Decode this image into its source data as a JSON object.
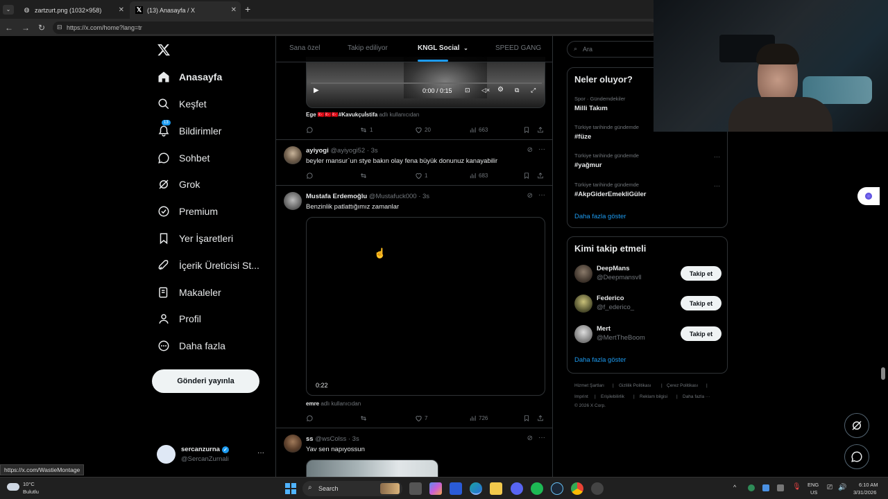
{
  "browser": {
    "tabs": [
      {
        "title": "zartzurt.png (1032×958)"
      },
      {
        "title": "(13) Anasayfa / X"
      }
    ],
    "url": "https://x.com/home?lang=tr"
  },
  "nav": {
    "items": [
      {
        "label": "Anasayfa"
      },
      {
        "label": "Keşfet"
      },
      {
        "label": "Bildirimler",
        "badge": "13"
      },
      {
        "label": "Sohbet"
      },
      {
        "label": "Grok"
      },
      {
        "label": "Premium"
      },
      {
        "label": "Yer İşaretleri"
      },
      {
        "label": "İçerik Üreticisi St..."
      },
      {
        "label": "Makaleler"
      },
      {
        "label": "Profil"
      },
      {
        "label": "Daha fazla"
      }
    ],
    "post_button": "Gönderi yayınla",
    "profile": {
      "name": "sercanzurna",
      "handle": "@SercanZurnali"
    }
  },
  "feed": {
    "tabs": [
      "Sana özel",
      "Takip ediliyor",
      "KNGL Social",
      "SPEED GANG"
    ],
    "video1": {
      "time": "0:00 / 0:15"
    },
    "tweet1": {
      "attrib_name": "Ege 🇹🇷🇹🇷🇹🇷#Kavukçuİstifa",
      "attrib_suffix": "adlı kullanıcıdan",
      "replies": "",
      "reposts": "1",
      "likes": "20",
      "views": "663"
    },
    "tweet2": {
      "name": "ayiyogi",
      "meta": "@ayiyogi52 · 3s",
      "text": "beyler mansur`un stye bakın olay fena büyük donunuz kanayabilir",
      "replies": "",
      "reposts": "",
      "likes": "1",
      "views": "683"
    },
    "tweet3": {
      "name": "Mustafa Erdemoğlu",
      "meta": "@Mustafuck000 · 3s",
      "text": "Benzinlik patlattığımız zamanlar",
      "duration": "0:22",
      "attrib_name": "emre",
      "attrib_suffix": "adlı kullanıcıdan",
      "replies": "",
      "reposts": "",
      "likes": "7",
      "views": "726"
    },
    "tweet4": {
      "name": "ss",
      "meta": "@wsColss · 3s",
      "text": "Yav sen napıyossun"
    }
  },
  "right": {
    "search_placeholder": "Ara",
    "trends_title": "Neler oluyor?",
    "trends": [
      {
        "meta": "Spor · Gündemdekiler",
        "name": "Milli Takım"
      },
      {
        "meta": "Türkiye tarihinde gündemde",
        "name": "#füze"
      },
      {
        "meta": "Türkiye tarihinde gündemde",
        "name": "#yağmur"
      },
      {
        "meta": "Türkiye tarihinde gündemde",
        "name": "#AkpGiderEmekliGüler"
      }
    ],
    "show_more": "Daha fazla göster",
    "who_title": "Kimi takip etmeli",
    "who": [
      {
        "name": "DeepMans",
        "handle": "@Deepmansvll",
        "button": "Takip et"
      },
      {
        "name": "Federico",
        "handle": "@f_ederico_",
        "button": "Takip et"
      },
      {
        "name": "Mert",
        "handle": "@MertTheBoom",
        "button": "Takip et"
      }
    ],
    "footer": [
      "Hizmet Şartları",
      "|",
      "Gizlilik Politikası",
      "|",
      "Çerez Politikası",
      "|",
      "Imprint",
      "|",
      "Erişilebilirlik",
      "|",
      "Reklam bilgisi",
      "|",
      "Daha fazla ···",
      "© 2026 X Corp."
    ]
  },
  "status_url": "https://x.com/WastieMontage",
  "taskbar": {
    "weather_temp": "10°C",
    "weather_desc": "Bulutlu",
    "search": "Search",
    "lang1": "ENG",
    "lang2": "US",
    "time": "6:10 AM",
    "date": "3/31/2026"
  }
}
